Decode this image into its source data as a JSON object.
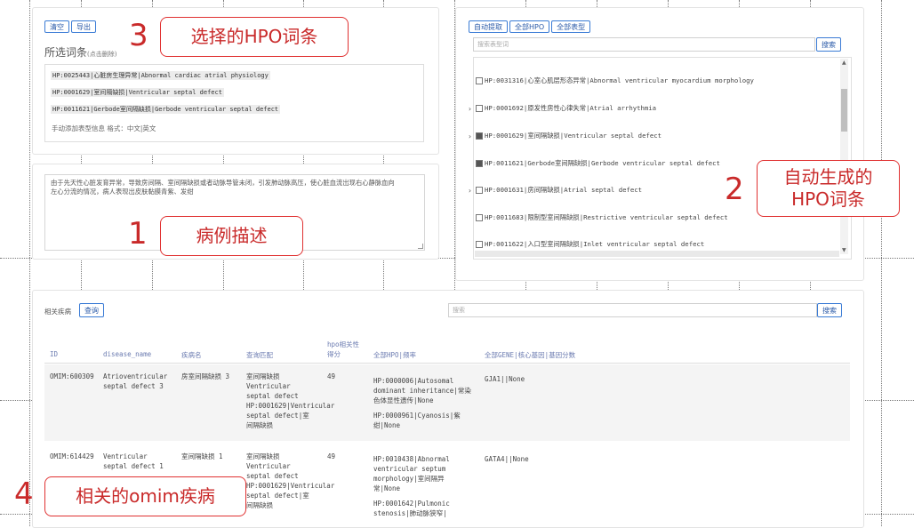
{
  "selected_panel": {
    "clear_label": "清空",
    "export_label": "导出",
    "title": "所选词条",
    "title_hint": "(点击删除)",
    "terms": [
      "HP:0025443|心脏房生理异常|Abnormal cardiac atrial physiology",
      "HP:0001629|室间隔缺损|Ventricular septal defect",
      "HP:0011621|Gerbode室间隔缺损|Gerbode ventricular septal defect"
    ],
    "manual_add_hint": "手动添加表型信息  格式：中文|英文"
  },
  "case_panel": {
    "description": "由于先天性心脏发育异常，导致房间隔、室间隔缺损或者动脉导管未闭，引发肺动脉高压，使心脏血流出现右心静脉血向左心分流的情况，病人表现出皮肤黏膜青紫、发绀"
  },
  "hpo_panel": {
    "auto_extract_label": "自动提取",
    "all_hpo_label": "全部HPO",
    "all_phenotype_label": "全部表型",
    "search_placeholder": "搜索表型词",
    "search_button": "搜索",
    "items": [
      {
        "text": "HP:0031316|心室心肌层形态异常|Abnormal ventricular myocardium morphology",
        "checked": false,
        "expandable": false
      },
      {
        "text": "HP:0001692|原发性房性心律失常|Atrial arrhythmia",
        "checked": false,
        "expandable": true
      },
      {
        "text": "HP:0001629|室间隔缺损|Ventricular septal defect",
        "checked": true,
        "expandable": true
      },
      {
        "text": "HP:0011621|Gerbode室间隔缺损|Gerbode ventricular septal defect",
        "checked": true,
        "expandable": false
      },
      {
        "text": "HP:0001631|房间隔缺损|Atrial septal defect",
        "checked": false,
        "expandable": true
      },
      {
        "text": "HP:0011683|限制型室间隔缺损|Restrictive ventricular septal defect",
        "checked": false,
        "expandable": false
      },
      {
        "text": "HP:0011622|入口型室间隔缺损|Inlet ventricular septal defect",
        "checked": false,
        "expandable": false
      }
    ]
  },
  "disease_panel": {
    "label": "相关疾病",
    "query_button": "查询",
    "search_placeholder": "搜索",
    "search_button": "搜索",
    "headers": {
      "id": "ID",
      "disease_name": "disease_name",
      "cn_name": "疾病名",
      "match": "查询匹配",
      "score_line1": "hpo相关性",
      "score_line2": "得分",
      "all_hpo": "全部HPO|频率",
      "all_gene": "全部GENE|核心基因|基因分数"
    },
    "rows": [
      {
        "id": "OMIM:600309",
        "disease_name": [
          "Atrioventricular",
          "septal defect 3"
        ],
        "cn_name": "房室间隔缺损 3",
        "match": [
          "室间隔缺损",
          "Ventricular",
          "septal defect",
          "HP:0001629|Ventricular",
          "septal defect|室",
          "间隔缺损"
        ],
        "score": "49",
        "all_hpo": [
          "HP:0000006|Autosomal",
          "dominant inheritance|常染",
          "色体显性遗传|None",
          "",
          "HP:0000961|Cyanosis|紫",
          "绀|None"
        ],
        "gene": "GJA1||None"
      },
      {
        "id": "OMIM:614429",
        "disease_name": [
          "Ventricular",
          "septal defect 1"
        ],
        "cn_name": "室间隔缺损 1",
        "match": [
          "室间隔缺损",
          "Ventricular",
          "septal defect",
          "HP:0001629|Ventricular",
          "septal defect|室",
          "间隔缺损"
        ],
        "score": "49",
        "all_hpo": [
          "HP:0010438|Abnormal",
          "ventricular septum",
          "morphology|室间隔异",
          "常|None",
          "",
          "HP:0001642|Pulmonic",
          "stenosis|肺动脉狭窄|"
        ],
        "gene": "GATA4||None"
      }
    ]
  },
  "annotations": [
    {
      "num": "1",
      "label": "病例描述"
    },
    {
      "num": "2",
      "label_line1": "自动生成的",
      "label_line2": "HPO词条"
    },
    {
      "num": "3",
      "label": "选择的HPO词条"
    },
    {
      "num": "4",
      "label": "相关的omim疾病"
    }
  ],
  "colors": {
    "accent": "#3a7bd5",
    "annotation": "#c92a2a"
  }
}
